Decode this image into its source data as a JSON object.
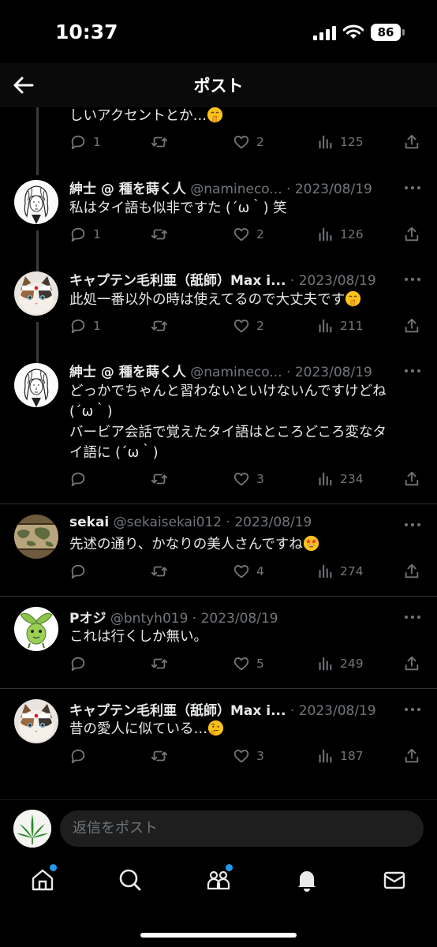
{
  "status": {
    "time": "10:37",
    "battery": "86"
  },
  "header": {
    "title": "ポスト"
  },
  "posts": [
    {
      "text": "しいアクセントとか…",
      "emoji": "shushing-face",
      "replies": "1",
      "likes": "2",
      "views": "125"
    },
    {
      "author": "紳士 @ 種を蒔く人",
      "handle": "@namineco...",
      "date": "2023/08/19",
      "text": "私はタイ語も似非ですた (´ω｀) 笑",
      "replies": "1",
      "likes": "2",
      "views": "126"
    },
    {
      "author": "キャプテン毛利亜（舐師）Max i...",
      "handle": "",
      "date": "2023/08/19",
      "text": "此処一番以外の時は使えてるので大丈夫です",
      "emoji": "shushing-face",
      "replies": "1",
      "likes": "2",
      "views": "211"
    },
    {
      "author": "紳士 @ 種を蒔く人",
      "handle": "@namineco...",
      "date": "2023/08/19",
      "text_lines": [
        "どっかでちゃんと習わないといけないんですけどね",
        "(´ω｀)",
        "バービア会話で覚えたタイ語はところどころ変なタ",
        "イ語に (´ω｀)"
      ],
      "replies": "",
      "likes": "3",
      "views": "234"
    },
    {
      "author": "sekai",
      "handle": "@sekaisekai012",
      "date": "2023/08/19",
      "text": "先述の通り、かなりの美人さんですね",
      "emoji": "star-struck",
      "replies": "",
      "likes": "4",
      "views": "274"
    },
    {
      "author": "Pオジ",
      "handle": "@bntyh019",
      "date": "2023/08/19",
      "text": "これは行くしか無い。",
      "replies": "",
      "likes": "5",
      "views": "249"
    },
    {
      "author": "キャプテン毛利亜（舐師）Max i...",
      "handle": "",
      "date": "2023/08/19",
      "text": "昔の愛人に似ている…",
      "emoji": "thinking-face",
      "replies": "",
      "likes": "3",
      "views": "187"
    }
  ],
  "sep": "·",
  "reply_box": {
    "placeholder": "返信をポスト"
  },
  "colors": {
    "background": "#000000",
    "secondary_text": "#71767b",
    "accent": "#1d9bf0",
    "divider": "#2f3336"
  }
}
